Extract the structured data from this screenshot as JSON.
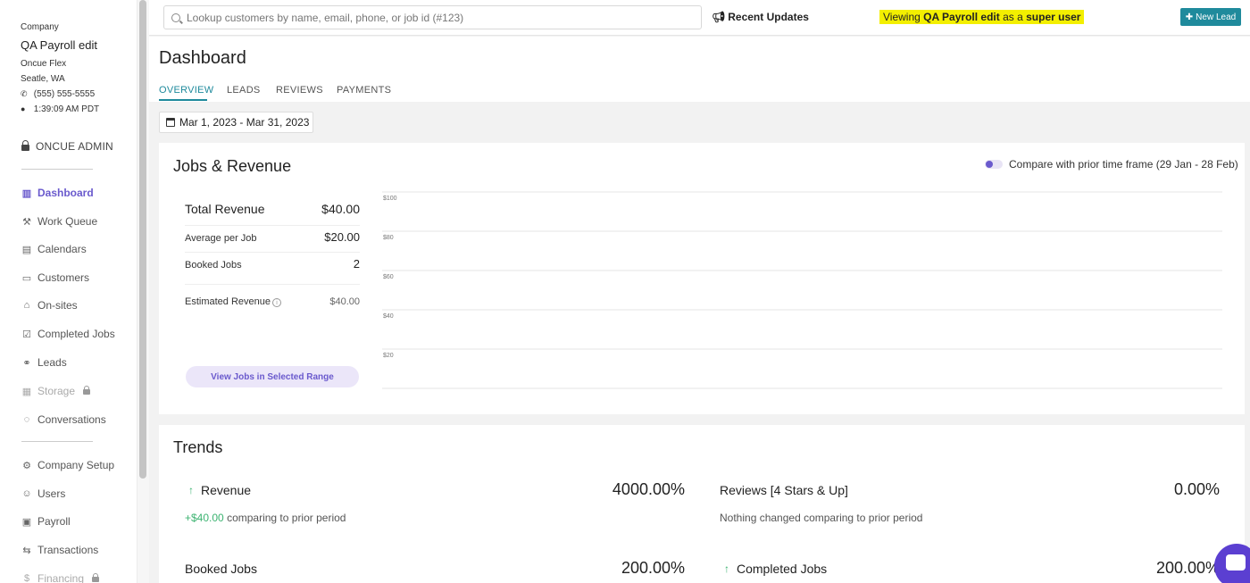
{
  "company": {
    "label": "Company",
    "name": "QA Payroll edit",
    "line1": "Oncue Flex",
    "line2": "Seatle, WA",
    "phone": "(555) 555-5555",
    "time": "1:39:09 AM PDT"
  },
  "sidebar": {
    "admin_label": "ONCUE ADMIN",
    "items": [
      {
        "label": "Dashboard",
        "icon": "chart-icon"
      },
      {
        "label": "Work Queue",
        "icon": "wrench-icon"
      },
      {
        "label": "Calendars",
        "icon": "calendar-icon"
      },
      {
        "label": "Customers",
        "icon": "truck-icon"
      },
      {
        "label": "On-sites",
        "icon": "home-icon"
      },
      {
        "label": "Completed Jobs",
        "icon": "check-square-icon"
      },
      {
        "label": "Leads",
        "icon": "link-icon"
      },
      {
        "label": "Storage",
        "icon": "warehouse-icon"
      },
      {
        "label": "Conversations",
        "icon": "chat-icon"
      },
      {
        "label": "Company Setup",
        "icon": "gear-icon"
      },
      {
        "label": "Users",
        "icon": "users-icon"
      },
      {
        "label": "Payroll",
        "icon": "payroll-icon"
      },
      {
        "label": "Transactions",
        "icon": "arrows-icon"
      },
      {
        "label": "Financing",
        "icon": "dollar-icon"
      }
    ]
  },
  "topbar": {
    "search_placeholder": "Lookup customers by name, email, phone, or job id (#123)",
    "recent_updates": "Recent Updates",
    "viewing_prefix": "Viewing",
    "viewing_company": "QA Payroll edit",
    "viewing_mid": "as a",
    "viewing_role": "super user",
    "new_lead": "New Lead"
  },
  "page": {
    "title": "Dashboard",
    "tabs": [
      "OVERVIEW",
      "LEADS",
      "REVIEWS",
      "PAYMENTS"
    ],
    "active_tab": "OVERVIEW",
    "date_range": "Mar 1, 2023 - Mar 31, 2023"
  },
  "jobs_revenue": {
    "title": "Jobs & Revenue",
    "compare_label": "Compare with prior time frame (29 Jan - 28 Feb)",
    "total_revenue_label": "Total Revenue",
    "total_revenue_value": "$40.00",
    "avg_label": "Average per Job",
    "avg_value": "$20.00",
    "booked_label": "Booked Jobs",
    "booked_value": "2",
    "estimated_label": "Estimated Revenue",
    "estimated_value": "$40.00",
    "view_button": "View Jobs in Selected Range"
  },
  "chart_data": {
    "type": "line",
    "title": "",
    "xlabel": "",
    "ylabel": "",
    "ylim": [
      0,
      100
    ],
    "yticks": [
      "$100",
      "$80",
      "$60",
      "$40",
      "$20"
    ],
    "series": []
  },
  "trends": {
    "title": "Trends",
    "items": [
      {
        "label": "Revenue",
        "pct": "4000.00%",
        "delta": "+$40.00",
        "sub": "comparing to prior period"
      },
      {
        "label": "Reviews [4 Stars & Up]",
        "pct": "0.00%",
        "sub": "Nothing changed comparing to prior period"
      },
      {
        "label": "Booked Jobs",
        "pct": "200.00%"
      },
      {
        "label": "Completed Jobs",
        "pct": "200.00%"
      }
    ]
  }
}
